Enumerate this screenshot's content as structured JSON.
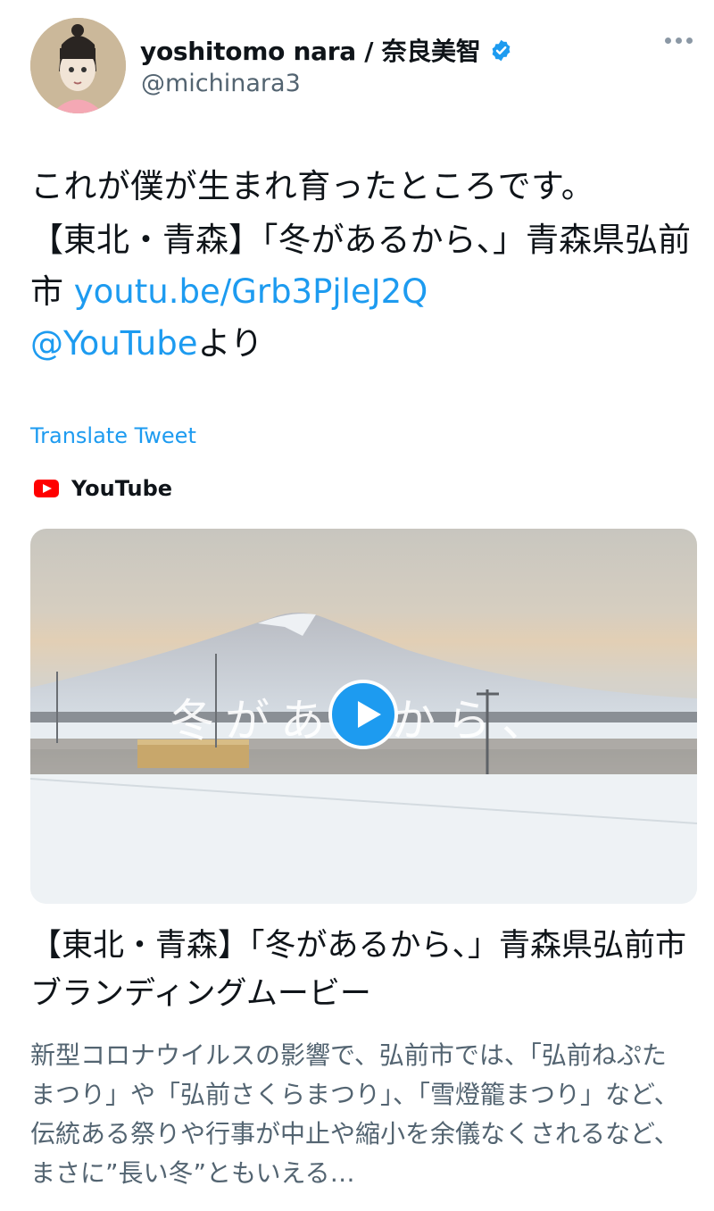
{
  "tweet": {
    "author": {
      "display_name": "yoshitomo nara / 奈良美智",
      "handle": "@michinara3",
      "verified": true,
      "avatar_icon": "avatar-illustration-girl"
    },
    "more_icon": "more-dots-icon",
    "text": {
      "line1": "これが僕が生まれ育ったところです。",
      "line2_prefix": "【東北・青森】「冬があるから、」青森県弘前市 ",
      "link_url_text": "youtu.be/Grb3PjleJ2Q",
      "mention": "@YouTube",
      "suffix": "より"
    },
    "translate_label": "Translate Tweet"
  },
  "card": {
    "source_label": "YouTube",
    "source_icon": "youtube-logo-icon",
    "thumbnail_overlay_text": "冬があるから、",
    "play_icon": "play-icon",
    "title": "【東北・青森】「冬があるから、」青森県弘前市ブランディングムービー",
    "description": "新型コロナウイルスの影響で、弘前市では、「弘前ねぷたまつり」や「弘前さくらまつり」、「雪燈籠まつり」など、伝統ある祭りや行事が中止や縮小を余儀なくされるなど、まさに”長い冬”ともいえる…"
  },
  "colors": {
    "link": "#1d9bf0",
    "text": "#0f1419",
    "secondary": "#536471",
    "youtube_red": "#ff0000"
  }
}
